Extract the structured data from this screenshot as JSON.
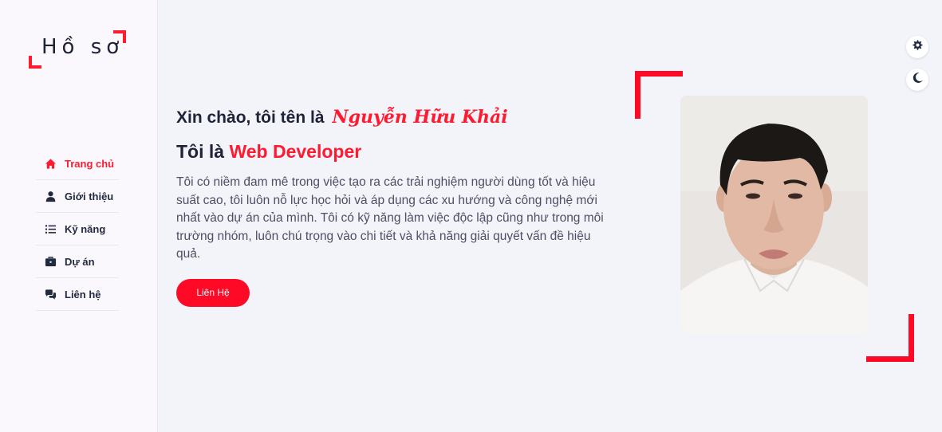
{
  "logo": {
    "text": "Hồ sơ"
  },
  "nav": {
    "items": [
      {
        "label": "Trang chủ",
        "icon": "home-icon",
        "active": true
      },
      {
        "label": "Giới thiệu",
        "icon": "user-icon",
        "active": false
      },
      {
        "label": "Kỹ năng",
        "icon": "list-icon",
        "active": false
      },
      {
        "label": "Dự án",
        "icon": "briefcase-icon",
        "active": false
      },
      {
        "label": "Liên hệ",
        "icon": "chat-icon",
        "active": false
      }
    ]
  },
  "controls": {
    "settings_icon": "gear-icon",
    "theme_icon": "moon-icon"
  },
  "hero": {
    "greeting": "Xin chào, tôi tên là",
    "name": "Nguyễn Hữu Khải",
    "role_prefix": "Tôi là",
    "role": "Web Developer",
    "description": "Tôi có niềm đam mê trong việc tạo ra các trải nghiệm người dùng tốt và hiệu suất cao, tôi luôn nỗ lực học hỏi và áp dụng các xu hướng và công nghệ mới nhất vào dự án của mình. Tôi có kỹ năng làm việc độc lập cũng như trong môi trường nhóm, luôn chú trọng vào chi tiết và khả năng giải quyết vấn đề hiệu quả.",
    "cta_label": "Liên Hệ"
  },
  "colors": {
    "accent": "#ff0a26",
    "text": "#1f2337",
    "background": "#f3f3fa",
    "sidebar": "#fbf8fd"
  }
}
